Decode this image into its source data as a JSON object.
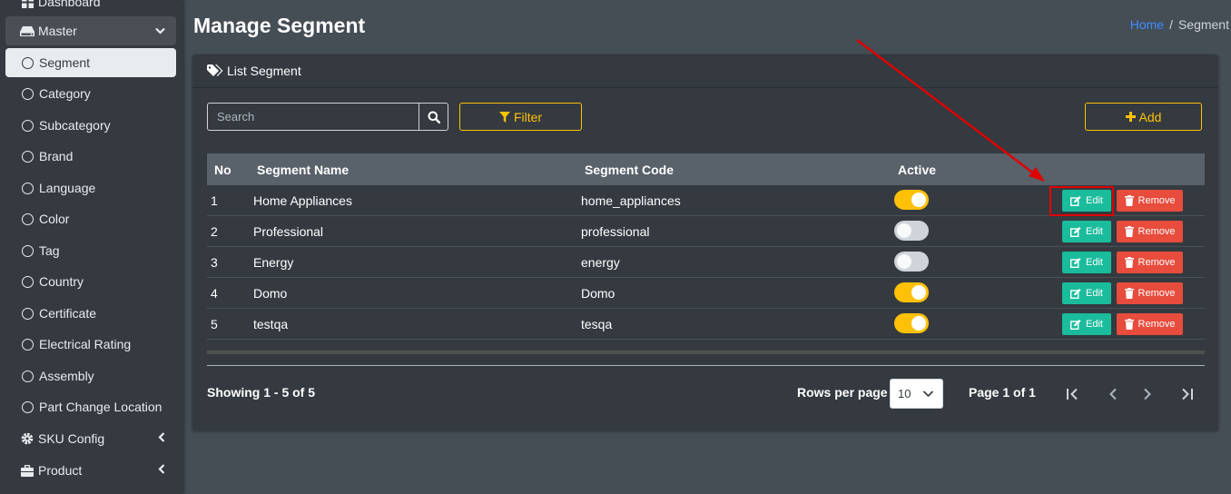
{
  "sidebar": {
    "dashboard": "Dashboard",
    "master": "Master",
    "items": [
      {
        "label": "Segment"
      },
      {
        "label": "Category"
      },
      {
        "label": "Subcategory"
      },
      {
        "label": "Brand"
      },
      {
        "label": "Language"
      },
      {
        "label": "Color"
      },
      {
        "label": "Tag"
      },
      {
        "label": "Country"
      },
      {
        "label": "Certificate"
      },
      {
        "label": "Electrical Rating"
      },
      {
        "label": "Assembly"
      },
      {
        "label": "Part Change Location"
      }
    ],
    "sku_config": "SKU Config",
    "product": "Product"
  },
  "header": {
    "title": "Manage Segment",
    "breadcrumb_home": "Home",
    "breadcrumb_sep": "/",
    "breadcrumb_current": "Segment"
  },
  "card": {
    "title": "List Segment",
    "search_placeholder": "Search",
    "filter_label": "Filter",
    "add_label": "Add"
  },
  "table": {
    "columns": {
      "no": "No",
      "name": "Segment Name",
      "code": "Segment Code",
      "active": "Active"
    },
    "rows": [
      {
        "no": "1",
        "name": "Home Appliances",
        "code": "home_appliances",
        "active": true
      },
      {
        "no": "2",
        "name": "Professional",
        "code": "professional",
        "active": false
      },
      {
        "no": "3",
        "name": "Energy",
        "code": "energy",
        "active": false
      },
      {
        "no": "4",
        "name": "Domo",
        "code": "Domo",
        "active": true
      },
      {
        "no": "5",
        "name": "testqa",
        "code": "tesqa",
        "active": true
      }
    ],
    "edit_label": "Edit",
    "remove_label": "Remove"
  },
  "footer": {
    "showing": "Showing 1 - 5 of 5",
    "rows_per_page_label": "Rows per page",
    "rows_per_page_value": "10",
    "page_info": "Page 1 of 1"
  },
  "colors": {
    "accent": "#ffc107",
    "edit": "#1abc9c",
    "remove": "#e74c3c",
    "link": "#3f8cff",
    "annotation": "#e00000"
  }
}
